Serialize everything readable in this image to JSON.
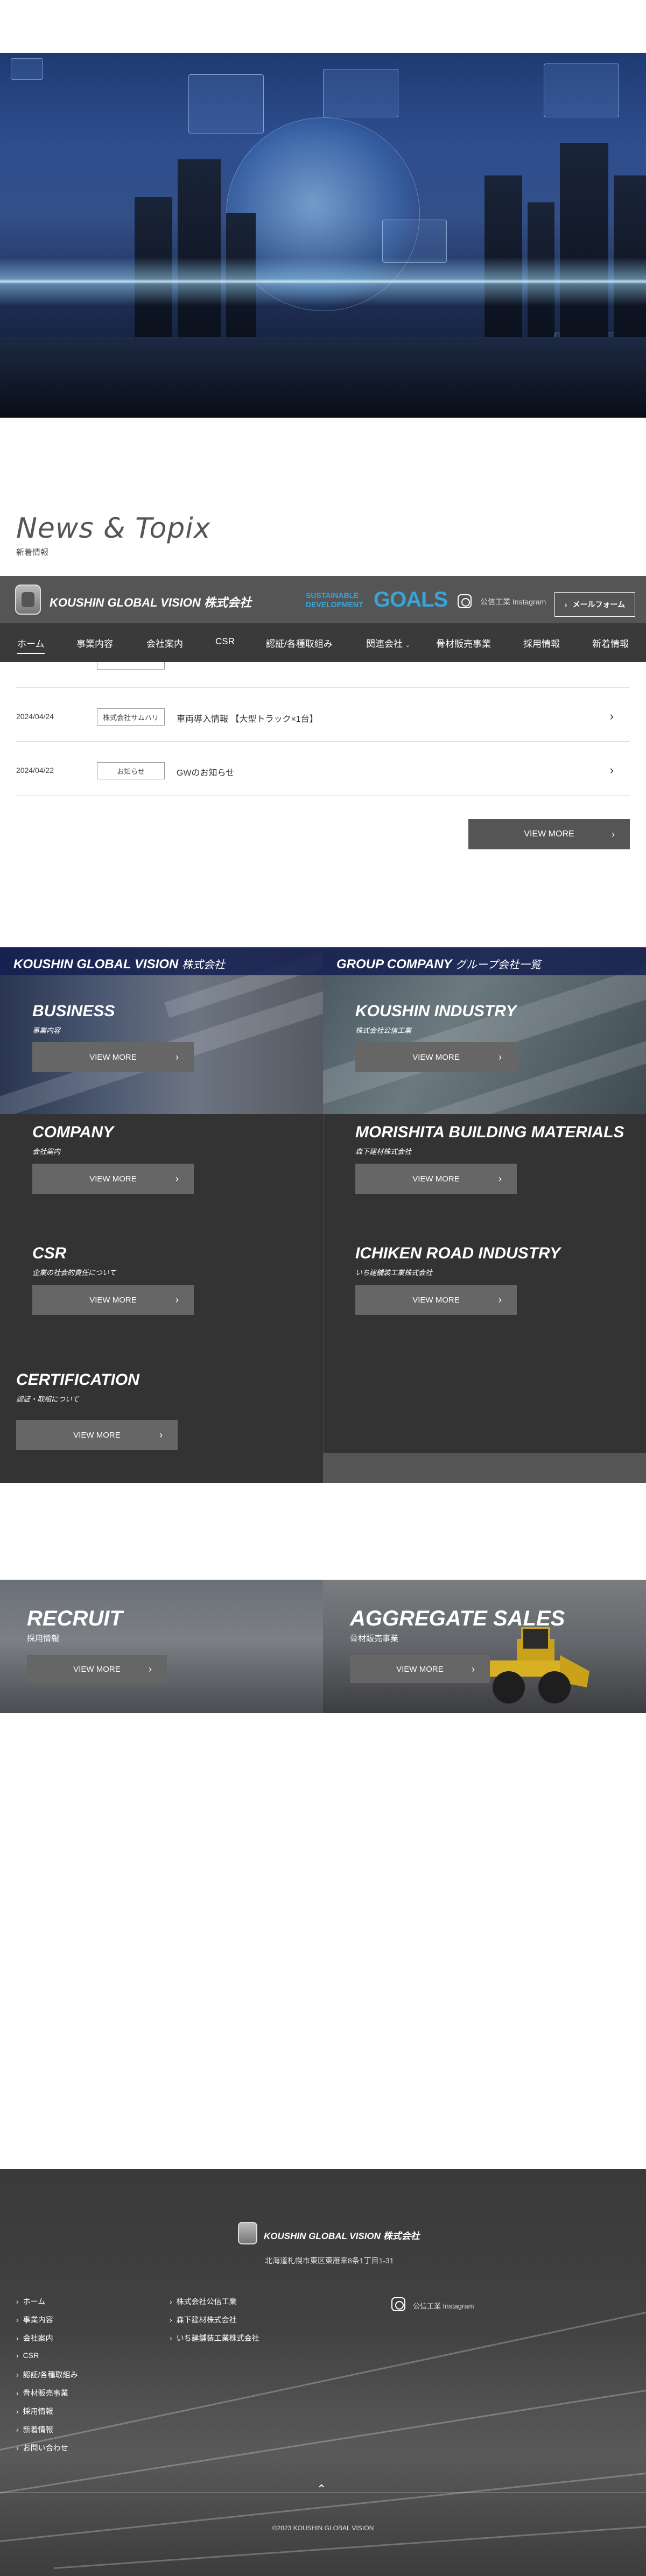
{
  "news_section": {
    "title": "News & Topix",
    "subtitle": "新着情報"
  },
  "header": {
    "logo_text": "KOUSHIN GLOBAL VISION 株式会社",
    "sdgs_line1": "SUSTAINABLE",
    "sdgs_line2": "DEVELOPMENT",
    "sdgs_goals": "GOALS",
    "instagram_label": "公信工業 Instagram",
    "mail_label": "メールフォーム"
  },
  "nav": [
    {
      "label": "ホーム"
    },
    {
      "label": "事業内容"
    },
    {
      "label": "会社案内"
    },
    {
      "label": "CSR"
    },
    {
      "label": "認証/各種取組み"
    },
    {
      "label": "関連会社"
    },
    {
      "label": "骨材販売事業"
    },
    {
      "label": "採用情報"
    },
    {
      "label": "新着情報"
    }
  ],
  "news_items": [
    {
      "date": "2024/04/24",
      "category": "株式会社サムハリ",
      "text": "車両導入情報 【大型トラック×1台】"
    },
    {
      "date": "2024/04/22",
      "category": "お知らせ",
      "text": "GWのお知らせ"
    }
  ],
  "news_viewmore": "VIEW MORE",
  "company_section": {
    "left_heading": "KOUSHIN GLOBAL VISION",
    "left_heading_suffix": "株式会社",
    "right_heading": "GROUP COMPANY",
    "right_heading_suffix": "グループ会社一覧",
    "entries_left": [
      {
        "title": "BUSINESS",
        "sub": "事業内容",
        "button": "VIEW MORE"
      },
      {
        "title": "COMPANY",
        "sub": "会社案内",
        "button": "VIEW MORE"
      },
      {
        "title": "CSR",
        "sub": "企業の社会的責任について",
        "button": "VIEW MORE"
      },
      {
        "title": "CERTIFICATION",
        "sub": "認証・取組について",
        "button": "VIEW MORE"
      }
    ],
    "entries_right": [
      {
        "title": "KOUSHIN INDUSTRY",
        "sub": "株式会社公信工業",
        "button": "VIEW MORE"
      },
      {
        "title": "MORISHITA BUILDING MATERIALS",
        "sub": "森下建材株式会社",
        "button": "VIEW MORE"
      },
      {
        "title": "ICHIKEN ROAD INDUSTRY",
        "sub": "いち建舗装工業株式会社",
        "button": "VIEW MORE"
      }
    ]
  },
  "recruit": {
    "left": {
      "title": "RECRUIT",
      "sub": "採用情報",
      "button": "VIEW MORE"
    },
    "right": {
      "title": "AGGREGATE SALES",
      "sub": "骨材販売事業",
      "button": "VIEW MORE"
    }
  },
  "footer": {
    "logo_text": "KOUSHIN GLOBAL VISION 株式会社",
    "address": "北海道札幌市東区東雁来8条1丁目1-31",
    "col1": [
      "ホーム",
      "事業内容",
      "会社案内",
      "CSR",
      "認証/各種取組み",
      "骨材販売事業",
      "採用情報",
      "新着情報",
      "お問い合わせ"
    ],
    "col2": [
      "株式会社公信工業",
      "森下建材株式会社",
      "いち建舗装工業株式会社"
    ],
    "instagram_label": "公信工業 Instagram",
    "copyright": "©2023 KOUSHIN GLOBAL VISION"
  },
  "colors": {
    "header_bg": "#555555",
    "nav_bg": "#3a3a3a",
    "heading_band": "#141e50",
    "sdgs_blue": "#3aa4d8"
  }
}
